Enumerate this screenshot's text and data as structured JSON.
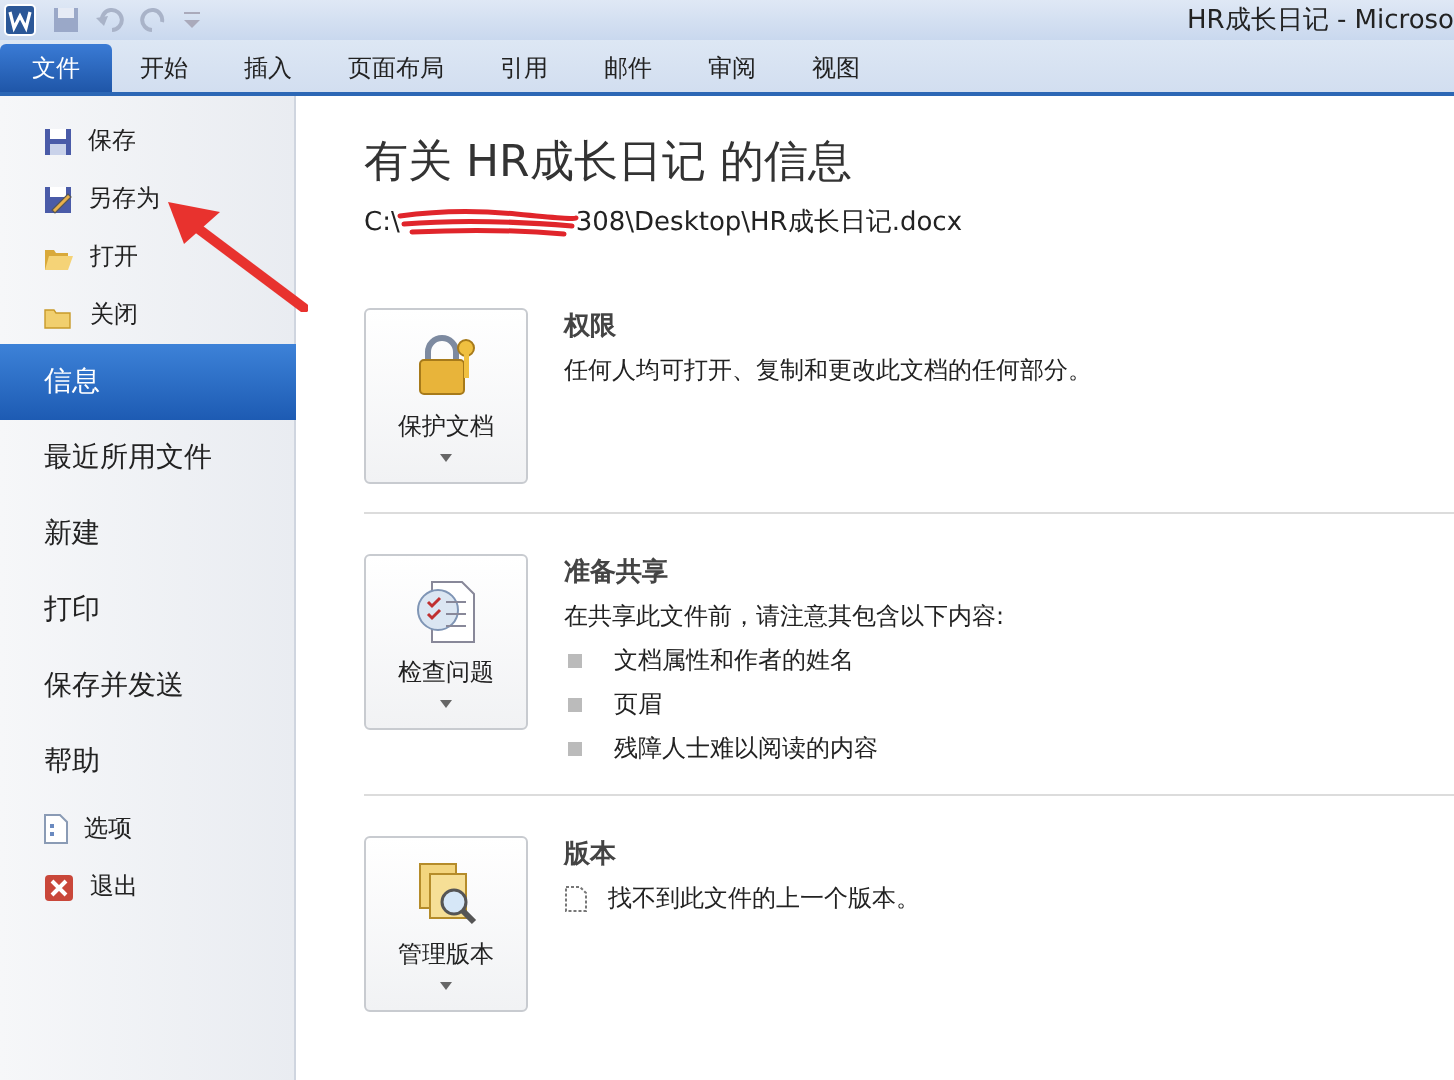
{
  "window": {
    "title": "HR成长日记  -  Microso"
  },
  "ribbon_tabs": [
    {
      "label": "文件",
      "selected": true
    },
    {
      "label": "开始",
      "selected": false
    },
    {
      "label": "插入",
      "selected": false
    },
    {
      "label": "页面布局",
      "selected": false
    },
    {
      "label": "引用",
      "selected": false
    },
    {
      "label": "邮件",
      "selected": false
    },
    {
      "label": "审阅",
      "selected": false
    },
    {
      "label": "视图",
      "selected": false
    }
  ],
  "sidebar": {
    "items": [
      {
        "kind": "command",
        "label": "保存",
        "selected": false
      },
      {
        "kind": "command",
        "label": "另存为",
        "selected": false
      },
      {
        "kind": "command",
        "label": "打开",
        "selected": false
      },
      {
        "kind": "command",
        "label": "关闭",
        "selected": false
      },
      {
        "kind": "page",
        "label": "信息",
        "selected": true
      },
      {
        "kind": "page",
        "label": "最近所用文件",
        "selected": false
      },
      {
        "kind": "page",
        "label": "新建",
        "selected": false
      },
      {
        "kind": "page",
        "label": "打印",
        "selected": false
      },
      {
        "kind": "page",
        "label": "保存并发送",
        "selected": false
      },
      {
        "kind": "page",
        "label": "帮助",
        "selected": false
      },
      {
        "kind": "command",
        "label": "选项",
        "selected": false
      },
      {
        "kind": "command",
        "label": "退出",
        "selected": false
      }
    ]
  },
  "info": {
    "title": "有关 HR成长日记 的信息",
    "path_start": "C:\\",
    "path_end": "308\\Desktop\\HR成长日记.docx",
    "sections": [
      {
        "button": "保护文档",
        "heading": "权限",
        "text": "任何人均可打开、复制和更改此文档的任何部分。"
      },
      {
        "button": "检查问题",
        "heading": "准备共享",
        "text": "在共享此文件前，请注意其包含以下内容:",
        "bullets": [
          "文档属性和作者的姓名",
          "页眉",
          "残障人士难以阅读的内容"
        ]
      },
      {
        "button": "管理版本",
        "heading": "版本",
        "note": "找不到此文件的上一个版本。"
      }
    ]
  }
}
